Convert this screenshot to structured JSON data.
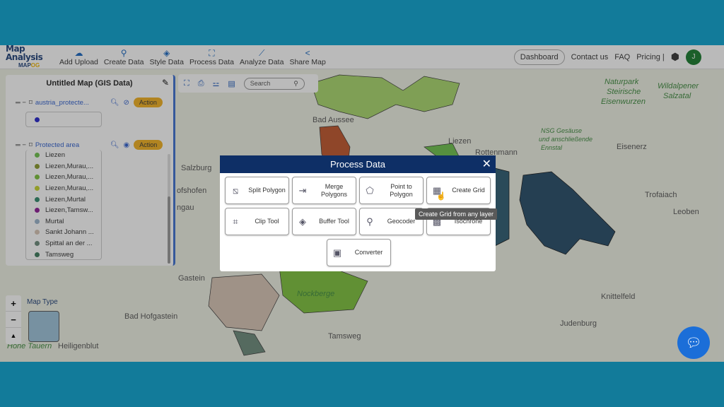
{
  "header": {
    "app_title": "Map Analysis",
    "brand": "MAPOG",
    "nav": [
      {
        "label": "Add Upload",
        "icon": "cloud-upload-icon"
      },
      {
        "label": "Create Data",
        "icon": "map-pin-icon"
      },
      {
        "label": "Style Data",
        "icon": "paint-bucket-icon"
      },
      {
        "label": "Process Data",
        "icon": "process-icon"
      },
      {
        "label": "Analyze Data",
        "icon": "analyze-icon"
      },
      {
        "label": "Share Map",
        "icon": "share-icon"
      }
    ],
    "dashboard": "Dashboard",
    "contact": "Contact us",
    "faq": "FAQ",
    "pricing": "Pricing |",
    "avatar_initial": "J"
  },
  "panel": {
    "title": "Untitled Map (GIS Data)",
    "layers": [
      {
        "name": "austria_protecte...",
        "action": "Action",
        "visible": false,
        "legend_color": "#2222cc"
      },
      {
        "name": "Protected area",
        "action": "Action",
        "visible": true
      }
    ],
    "legend": [
      {
        "label": "Liezen",
        "color": "#6cc24a"
      },
      {
        "label": "Liezen,Murau,...",
        "color": "#8a9a2a"
      },
      {
        "label": "Liezen,Murau,...",
        "color": "#7dc23a"
      },
      {
        "label": "Liezen,Murau,...",
        "color": "#c4d42a"
      },
      {
        "label": "Liezen,Murtal",
        "color": "#2e8a6a"
      },
      {
        "label": "Liezen,Tamsw...",
        "color": "#8e1a96"
      },
      {
        "label": "Murtal",
        "color": "#9ab4cc"
      },
      {
        "label": "Sankt Johann ...",
        "color": "#d8c4b4"
      },
      {
        "label": "Spittal an der ...",
        "color": "#6a8a7a"
      },
      {
        "label": "Tamsweg",
        "color": "#3a7a5a"
      }
    ]
  },
  "toolbar": {
    "search_placeholder": "Search"
  },
  "map": {
    "map_type": "Map Type",
    "zoom_in": "+",
    "zoom_out": "−",
    "north": "▲",
    "labels": [
      "Naturpark",
      "Steirische",
      "Eisenwurzen",
      "Wildalpener",
      "Salzatal",
      "Bad Aussee",
      "Liezen",
      "Rottenmann",
      "NSG Gesäuse",
      "und anschließende",
      "Ennstal",
      "Eisenerz",
      "Salzburg",
      "Trofaiach",
      "Leoben",
      "Knittelfeld",
      "Judenburg",
      "Tamsweg",
      "Nockberge",
      "Bad Hofgastein",
      "Hohe Tauern",
      "Heiligenblut",
      "ofshofen",
      "ngau",
      "Gastein"
    ]
  },
  "modal": {
    "title": "Process Data",
    "tools": [
      {
        "label": "Split Polygon"
      },
      {
        "label": "Merge Polygons"
      },
      {
        "label": "Point to Polygon"
      },
      {
        "label": "Create Grid"
      },
      {
        "label": "Clip Tool"
      },
      {
        "label": "Buffer Tool"
      },
      {
        "label": "Geocoder"
      },
      {
        "label": "Isochrone"
      },
      {
        "label": "Converter"
      }
    ],
    "tooltip": "Create Grid from any layer"
  }
}
